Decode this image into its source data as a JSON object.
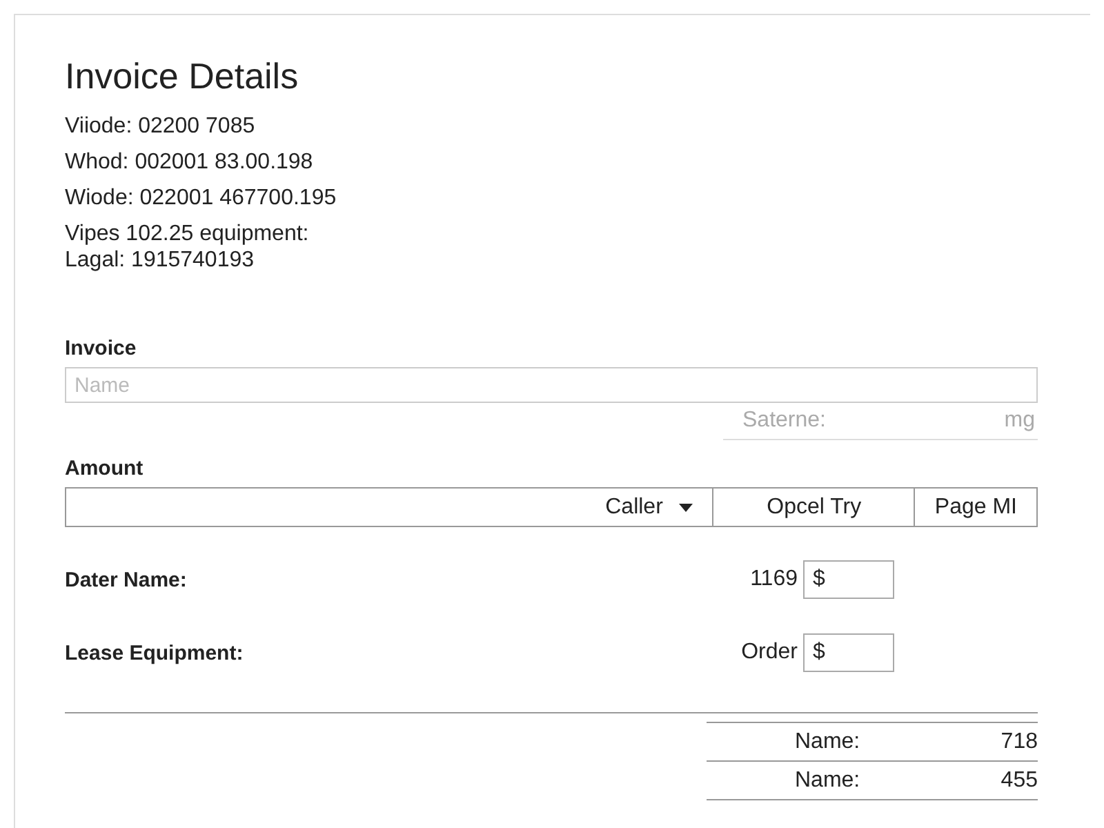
{
  "title": "Invoice Details",
  "info_lines": [
    "Viiode: 02200 7085",
    "Whod: 002001 83.00.198",
    "Wiode: 022001 467700.195",
    "Vipes 102.25 equipment:",
    "Lagal: 1915740193"
  ],
  "invoice": {
    "label": "Invoice",
    "name_field": {
      "placeholder": "Name"
    },
    "unit_row": {
      "label": "Saterne:",
      "unit": "mg"
    }
  },
  "amount": {
    "label": "Amount",
    "dropdown": {
      "value": "Caller"
    },
    "buttons": [
      "Opcel Try",
      "Page MI"
    ]
  },
  "fields": [
    {
      "label": "Dater Name:",
      "prefix": "1169",
      "value": "$"
    },
    {
      "label": "Lease Equipment:",
      "prefix": "Order",
      "value": "$"
    }
  ],
  "summary": [
    {
      "label": "Name:",
      "value": "718"
    },
    {
      "label": "Name:",
      "value": "455"
    }
  ]
}
